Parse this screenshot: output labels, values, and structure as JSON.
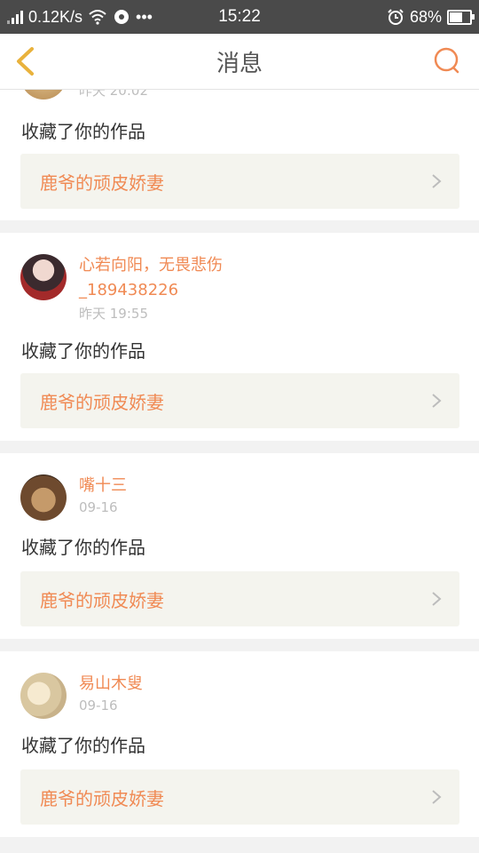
{
  "status": {
    "net_speed": "0.12K/s",
    "time": "15:22",
    "battery": "68%",
    "battery_level": 0.68
  },
  "header": {
    "title": "消息"
  },
  "messages": [
    {
      "user": "",
      "time": "昨天 20:02",
      "action": "收藏了你的作品",
      "work_title": "鹿爷的顽皮娇妻"
    },
    {
      "user_line1": "心若向阳，无畏悲伤",
      "user_line2": "_189438226",
      "time": "昨天 19:55",
      "action": "收藏了你的作品",
      "work_title": "鹿爷的顽皮娇妻"
    },
    {
      "user": "嘴十三",
      "time": "09-16",
      "action": "收藏了你的作品",
      "work_title": "鹿爷的顽皮娇妻"
    },
    {
      "user": "易山木叟",
      "time": "09-16",
      "action": "收藏了你的作品",
      "work_title": "鹿爷的顽皮娇妻"
    }
  ],
  "colors": {
    "accent": "#f08a54",
    "back_arrow": "#e9b23c",
    "statusbar": "#4a4a4a"
  },
  "icons": [
    "back-arrow-icon",
    "search-icon",
    "chevron-right-icon",
    "wifi-icon",
    "alarm-icon",
    "battery-icon",
    "signal-icon"
  ]
}
